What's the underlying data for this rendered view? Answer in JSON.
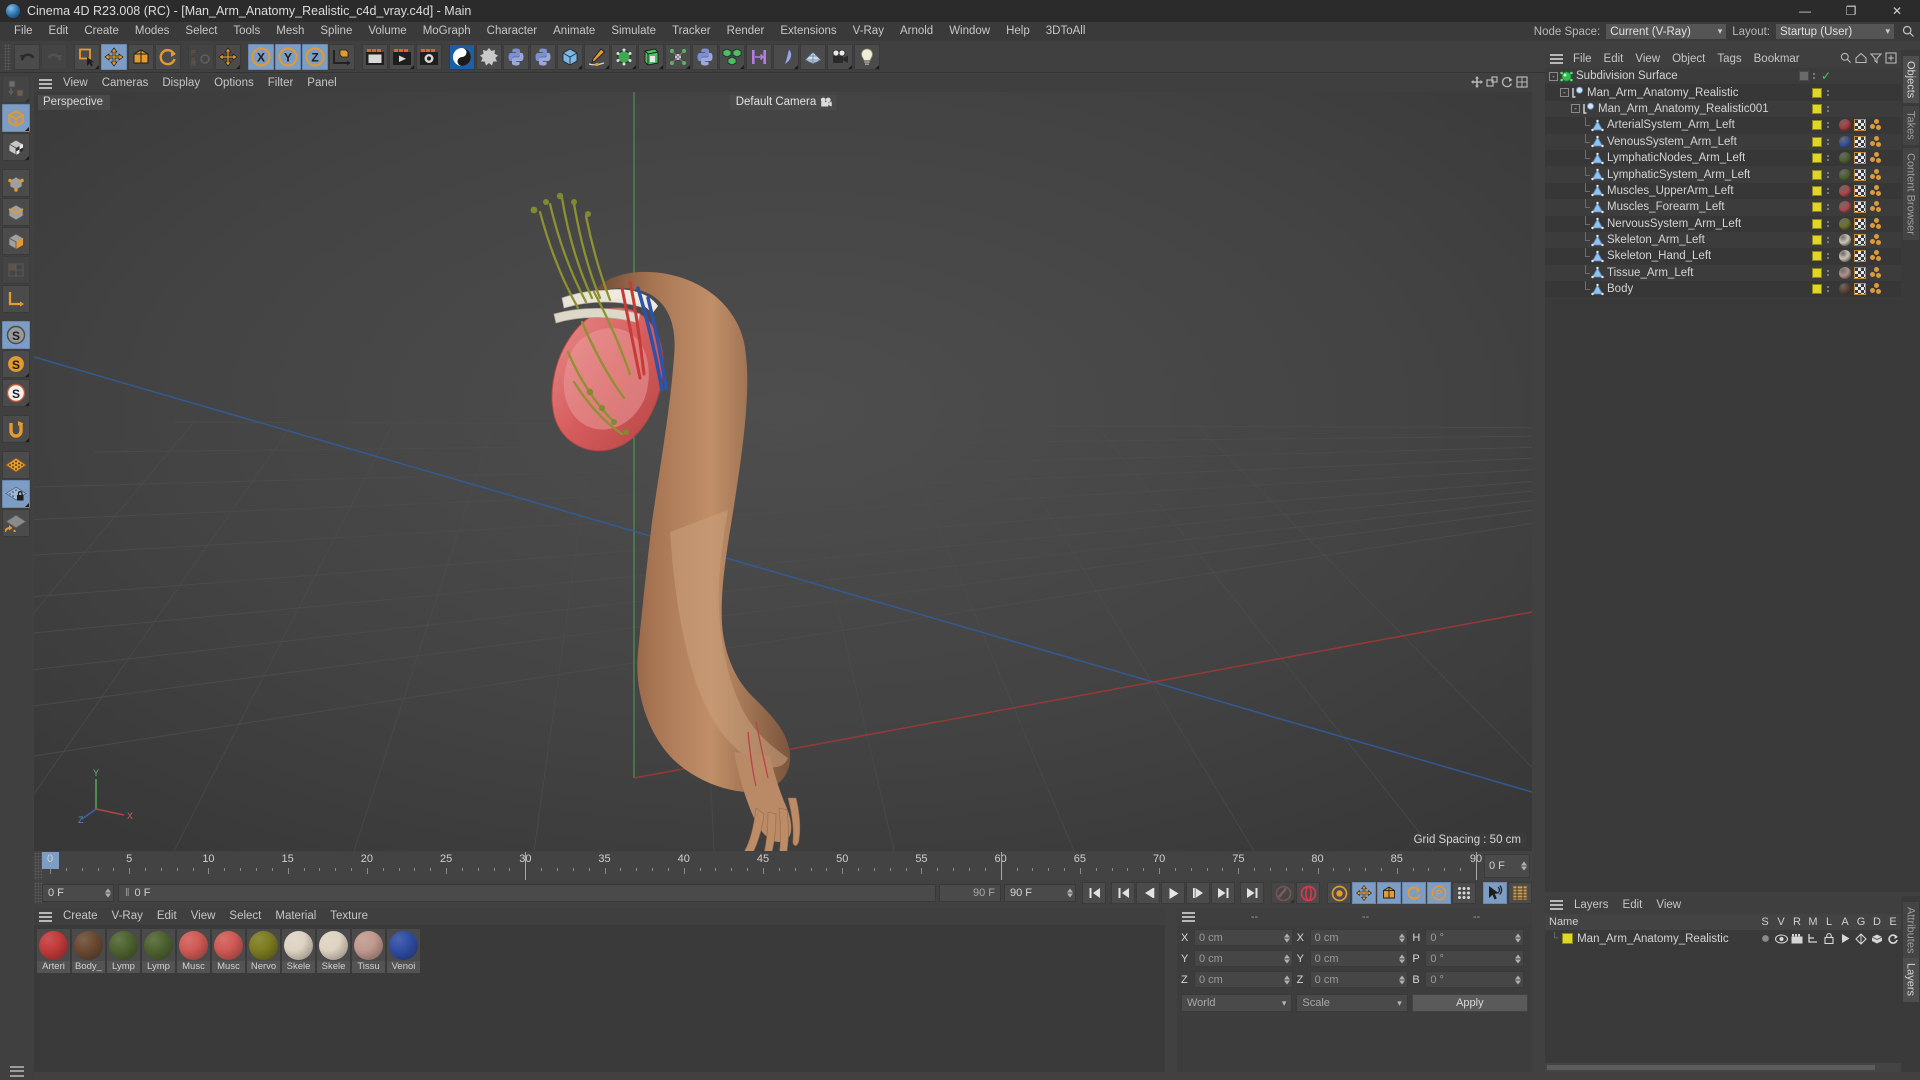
{
  "window": {
    "title": "Cinema 4D R23.008 (RC) - [Man_Arm_Anatomy_Realistic_c4d_vray.c4d] - Main",
    "minimize": "—",
    "maximize": "❐",
    "close": "✕"
  },
  "menubar": {
    "items": [
      "File",
      "Edit",
      "Create",
      "Modes",
      "Select",
      "Tools",
      "Mesh",
      "Spline",
      "Volume",
      "MoGraph",
      "Character",
      "Animate",
      "Simulate",
      "Tracker",
      "Render",
      "Extensions",
      "V-Ray",
      "Arnold",
      "Window",
      "Help",
      "3DToAll"
    ],
    "node_space_label": "Node Space:",
    "node_space_value": "Current (V-Ray)",
    "layout_label": "Layout:",
    "layout_value": "Startup (User)",
    "search_icon": "search-icon"
  },
  "viewport": {
    "menu": [
      "View",
      "Cameras",
      "Display",
      "Options",
      "Filter",
      "Panel"
    ],
    "perspective_label": "Perspective",
    "camera_label": "Default Camera",
    "grid_spacing": "Grid Spacing : 50 cm",
    "axis": {
      "x": "X",
      "y": "Y",
      "z": "Z"
    }
  },
  "timeline": {
    "numbers": [
      0,
      5,
      10,
      15,
      20,
      25,
      30,
      35,
      40,
      45,
      50,
      55,
      60,
      65,
      70,
      75,
      80,
      85,
      90
    ],
    "current_frame_field": "0 F",
    "markers": [
      30,
      60,
      90
    ]
  },
  "transport": {
    "start_frame": "0 F",
    "current_frame": "0 F",
    "preview_field": "90 F",
    "end_frame": "90 F",
    "buttons": [
      "go-to-start-button",
      "go-to-previous-keyframe-button",
      "step-back-button",
      "play-button",
      "step-forward-button",
      "go-to-next-keyframe-button",
      "go-to-end-button",
      "record-active-objects-button",
      "autokeying-button",
      "keyframe-settings-button",
      "position-key-button",
      "scale-key-button",
      "rotation-key-button",
      "parameter-key-button",
      "point-level-animation-button",
      "animation-mode-button",
      "timeline-button"
    ]
  },
  "material_manager": {
    "menu": [
      "Create",
      "V-Ray",
      "Edit",
      "View",
      "Select",
      "Material",
      "Texture"
    ],
    "materials": [
      {
        "name": "Arteri",
        "color": "#c23a3a"
      },
      {
        "name": "Body_",
        "color": "#6b4a33"
      },
      {
        "name": "Lymp",
        "color": "#4e6330"
      },
      {
        "name": "Lymp",
        "color": "#4e6330"
      },
      {
        "name": "Musc",
        "color": "#d05a55"
      },
      {
        "name": "Musc",
        "color": "#d05a55"
      },
      {
        "name": "Nervo",
        "color": "#7d7c20"
      },
      {
        "name": "Skele",
        "color": "#ded3c2"
      },
      {
        "name": "Skele",
        "color": "#ded3c2"
      },
      {
        "name": "Tissu",
        "color": "#c1998e"
      },
      {
        "name": "Venoi",
        "color": "#2f4da3"
      }
    ]
  },
  "coordinates": {
    "header_dashes": [
      "--",
      "--",
      "--"
    ],
    "rows": [
      {
        "label_pos": "X",
        "value_pos": "0 cm",
        "label_size": "X",
        "value_size": "0 cm",
        "label_rot": "H",
        "value_rot": "0 °"
      },
      {
        "label_pos": "Y",
        "value_pos": "0 cm",
        "label_size": "Y",
        "value_size": "0 cm",
        "label_rot": "P",
        "value_rot": "0 °"
      },
      {
        "label_pos": "Z",
        "value_pos": "0 cm",
        "label_size": "Z",
        "value_size": "0 cm",
        "label_rot": "B",
        "value_rot": "0 °"
      }
    ],
    "coord_system": "World",
    "transform_mode": "Scale",
    "apply_label": "Apply"
  },
  "object_manager": {
    "menu": [
      "File",
      "Edit",
      "View",
      "Object",
      "Tags",
      "Bookmar"
    ],
    "items": [
      {
        "name": "Subdivision Surface",
        "depth": 0,
        "expander": "-",
        "icon": "subdivision-surface-icon",
        "layer_color": "none",
        "has_tags": false,
        "checked": true
      },
      {
        "name": "Man_Arm_Anatomy_Realistic",
        "depth": 1,
        "expander": "-",
        "icon": "null-object-icon",
        "layer_color": "#e0d628",
        "has_tags": false
      },
      {
        "name": "Man_Arm_Anatomy_Realistic001",
        "depth": 2,
        "expander": "-",
        "icon": "null-object-icon",
        "layer_color": "#e0d628",
        "has_tags": false
      },
      {
        "name": "ArterialSystem_Arm_Left",
        "depth": 3,
        "expander": "",
        "icon": "polygon-object-icon",
        "layer_color": "#e0d628",
        "has_tags": true,
        "mat_color": "#b03a3a"
      },
      {
        "name": "VenousSystem_Arm_Left",
        "depth": 3,
        "expander": "",
        "icon": "polygon-object-icon",
        "layer_color": "#e0d628",
        "has_tags": true,
        "mat_color": "#36529c"
      },
      {
        "name": "LymphaticNodes_Arm_Left",
        "depth": 3,
        "expander": "",
        "icon": "polygon-object-icon",
        "layer_color": "#e0d628",
        "has_tags": true,
        "mat_color": "#4d6130"
      },
      {
        "name": "LymphaticSystem_Arm_Left",
        "depth": 3,
        "expander": "",
        "icon": "polygon-object-icon",
        "layer_color": "#e0d628",
        "has_tags": true,
        "mat_color": "#4d6130"
      },
      {
        "name": "Muscles_UpperArm_Left",
        "depth": 3,
        "expander": "",
        "icon": "polygon-object-icon",
        "layer_color": "#e0d628",
        "has_tags": true,
        "mat_color": "#b0474a"
      },
      {
        "name": "Muscles_Forearm_Left",
        "depth": 3,
        "expander": "",
        "icon": "polygon-object-icon",
        "layer_color": "#e0d628",
        "has_tags": true,
        "mat_color": "#b0474a"
      },
      {
        "name": "NervousSystem_Arm_Left",
        "depth": 3,
        "expander": "",
        "icon": "polygon-object-icon",
        "layer_color": "#e0d628",
        "has_tags": true,
        "mat_color": "#70702a"
      },
      {
        "name": "Skeleton_Arm_Left",
        "depth": 3,
        "expander": "",
        "icon": "polygon-object-icon",
        "layer_color": "#e0d628",
        "has_tags": true,
        "mat_color": "#ccc3b4"
      },
      {
        "name": "Skeleton_Hand_Left",
        "depth": 3,
        "expander": "",
        "icon": "polygon-object-icon",
        "layer_color": "#e0d628",
        "has_tags": true,
        "mat_color": "#ccc3b4"
      },
      {
        "name": "Tissue_Arm_Left",
        "depth": 3,
        "expander": "",
        "icon": "polygon-object-icon",
        "layer_color": "#e0d628",
        "has_tags": true,
        "mat_color": "#b4908a"
      },
      {
        "name": "Body",
        "depth": 3,
        "expander": "",
        "icon": "polygon-object-icon",
        "layer_color": "#e0d628",
        "has_tags": true,
        "mat_color": "#5d4130"
      }
    ],
    "side_tabs": [
      "Objects",
      "Takes",
      "Content Browser"
    ]
  },
  "layers": {
    "menu": [
      "Layers",
      "Edit",
      "View"
    ],
    "columns": [
      "Name",
      "S",
      "V",
      "R",
      "M",
      "L",
      "A",
      "G",
      "D",
      "E"
    ],
    "rows": [
      {
        "name": "Man_Arm_Anatomy_Realistic",
        "color": "#e0d628"
      }
    ],
    "side_tabs": [
      "Attributes",
      "Layers"
    ]
  }
}
